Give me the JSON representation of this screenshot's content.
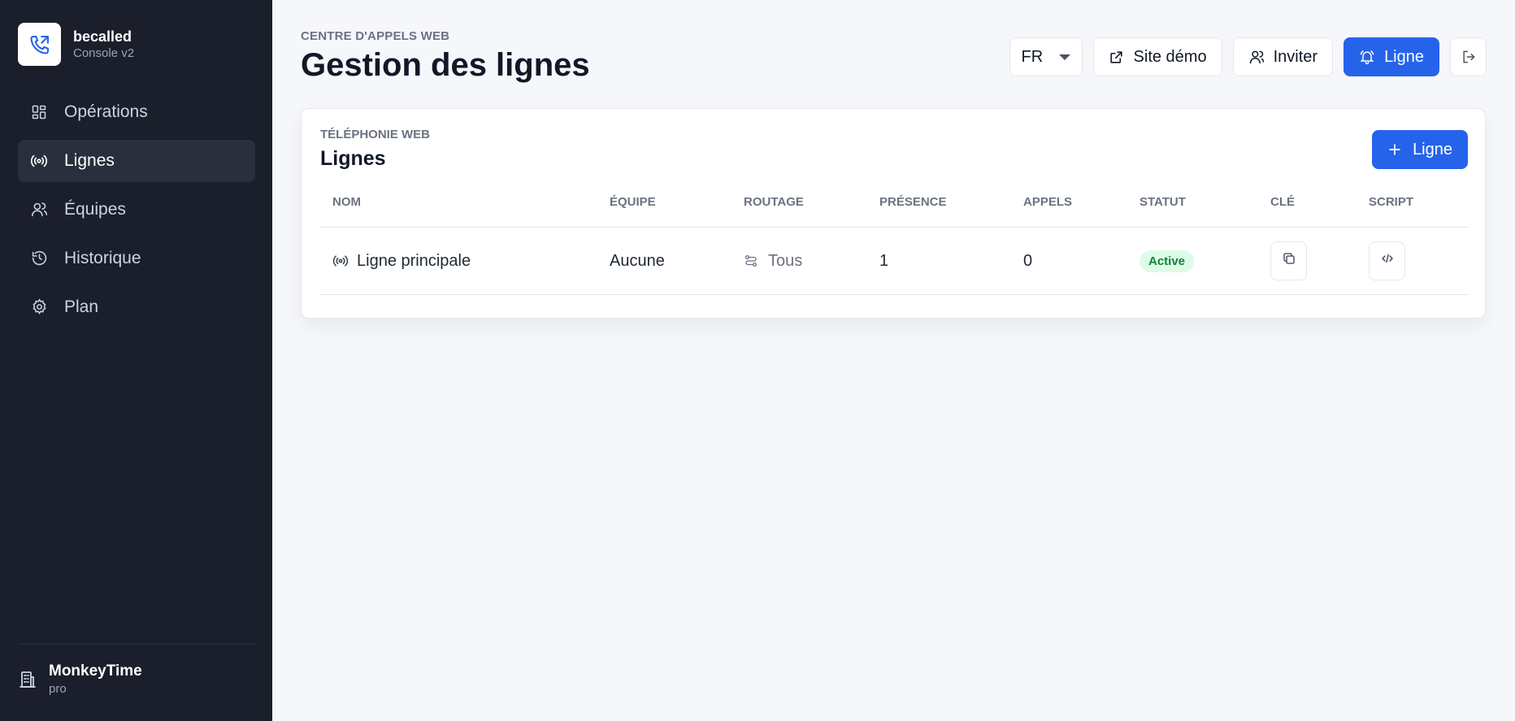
{
  "brand": {
    "name": "becalled",
    "subtitle": "Console v2",
    "logo_icon": "phone-forward-icon",
    "accent": "#2563eb"
  },
  "sidebar": {
    "items": [
      {
        "label": "Opérations",
        "icon": "dashboard-grid-icon",
        "active": false
      },
      {
        "label": "Lignes",
        "icon": "broadcast-icon",
        "active": true
      },
      {
        "label": "Équipes",
        "icon": "users-icon",
        "active": false
      },
      {
        "label": "Historique",
        "icon": "history-icon",
        "active": false
      },
      {
        "label": "Plan",
        "icon": "gear-icon",
        "active": false
      }
    ],
    "org": {
      "name": "MonkeyTime",
      "plan": "pro",
      "icon": "building-icon"
    }
  },
  "header": {
    "eyebrow": "CENTRE D'APPELS WEB",
    "title": "Gestion des lignes"
  },
  "toolbar": {
    "language": "FR",
    "demo_label": "Site démo",
    "invite_label": "Inviter",
    "line_label": "Ligne",
    "logout_icon": "logout-icon"
  },
  "card": {
    "eyebrow": "TÉLÉPHONIE WEB",
    "title": "Lignes",
    "add_label": "Ligne",
    "columns": [
      "NOM",
      "ÉQUIPE",
      "ROUTAGE",
      "PRÉSENCE",
      "APPELS",
      "STATUT",
      "CLÉ",
      "SCRIPT"
    ],
    "rows": [
      {
        "name": "Ligne principale",
        "team": "Aucune",
        "routing": "Tous",
        "presence": "1",
        "calls": "0",
        "status": "Active"
      }
    ]
  },
  "colors": {
    "sidebar_bg": "#1b1f2b",
    "primary": "#2563eb",
    "status_active_bg": "#dcfce7",
    "status_active_text": "#15803d"
  }
}
